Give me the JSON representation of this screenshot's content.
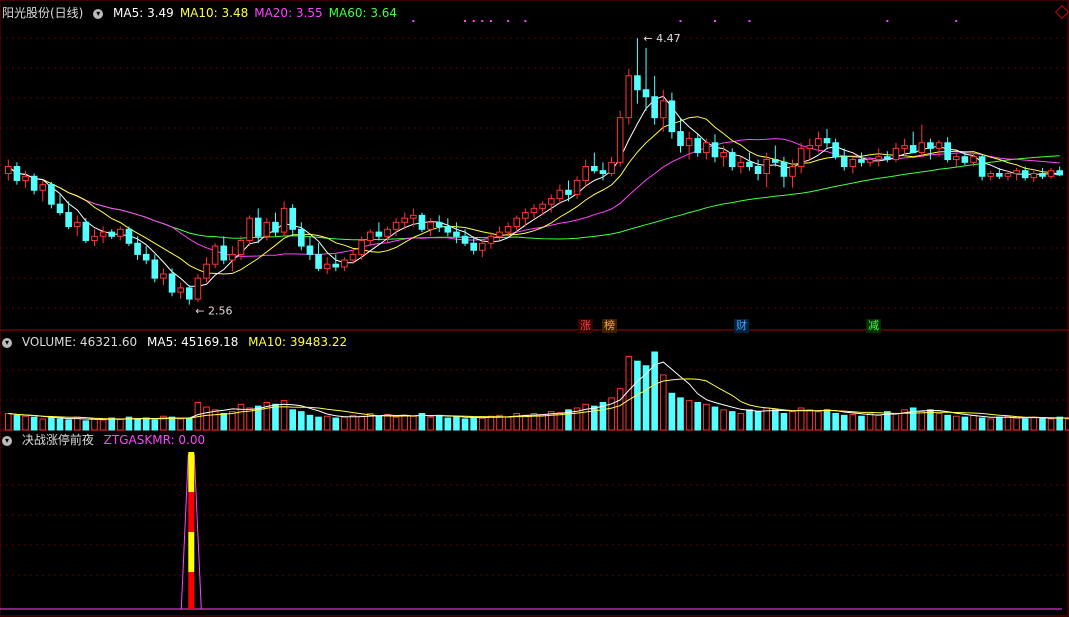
{
  "main_panel": {
    "title": "阳光股份(日线)",
    "ma_labels": [
      {
        "text": "MA5: 3.49",
        "color": "#ffffff"
      },
      {
        "text": "MA10: 3.48",
        "color": "#ffff44"
      },
      {
        "text": "MA20: 3.55",
        "color": "#ff44ff"
      },
      {
        "text": "MA60: 3.64",
        "color": "#44ff44"
      }
    ],
    "high_label": "4.47",
    "low_label": "2.56",
    "markers": [
      {
        "text": "涨",
        "color": "#ff4444",
        "bg": "#3a0000"
      },
      {
        "text": "榜",
        "color": "#ffaa44",
        "bg": "#3a2000"
      },
      {
        "text": "财",
        "color": "#44aaff",
        "bg": "#002040"
      },
      {
        "text": "减",
        "color": "#44ff44",
        "bg": "#003000"
      }
    ]
  },
  "volume_panel": {
    "title": "VOLUME: 46321.60",
    "ma5": "MA5: 45169.18",
    "ma10": "MA10: 39483.22"
  },
  "indicator_panel": {
    "title": "决战涨停前夜",
    "value": "ZTGASKMR: 0.00"
  },
  "chart_data": {
    "type": "candlestick",
    "ma_current": {
      "MA5": 3.49,
      "MA10": 3.48,
      "MA20": 3.55,
      "MA60": 3.64
    },
    "price_high": 4.47,
    "price_low": 2.56,
    "price_range": [
      2.45,
      4.6
    ],
    "candles": [
      [
        3.5,
        3.6,
        3.45,
        3.55
      ],
      [
        3.55,
        3.58,
        3.42,
        3.45
      ],
      [
        3.45,
        3.52,
        3.4,
        3.48
      ],
      [
        3.48,
        3.5,
        3.35,
        3.38
      ],
      [
        3.38,
        3.45,
        3.3,
        3.42
      ],
      [
        3.42,
        3.44,
        3.25,
        3.28
      ],
      [
        3.28,
        3.35,
        3.2,
        3.22
      ],
      [
        3.22,
        3.3,
        3.1,
        3.12
      ],
      [
        3.12,
        3.2,
        3.05,
        3.15
      ],
      [
        3.15,
        3.18,
        3.0,
        3.02
      ],
      [
        3.02,
        3.1,
        2.98,
        3.05
      ],
      [
        3.05,
        3.12,
        3.0,
        3.08
      ],
      [
        3.08,
        3.1,
        3.03,
        3.05
      ],
      [
        3.05,
        3.12,
        3.02,
        3.1
      ],
      [
        3.1,
        3.12,
        2.98,
        3.0
      ],
      [
        3.0,
        3.05,
        2.88,
        2.92
      ],
      [
        2.92,
        2.98,
        2.85,
        2.88
      ],
      [
        2.88,
        2.92,
        2.72,
        2.75
      ],
      [
        2.75,
        2.82,
        2.7,
        2.78
      ],
      [
        2.78,
        2.82,
        2.62,
        2.65
      ],
      [
        2.65,
        2.72,
        2.6,
        2.68
      ],
      [
        2.68,
        2.7,
        2.56,
        2.6
      ],
      [
        2.6,
        2.78,
        2.58,
        2.75
      ],
      [
        2.75,
        2.9,
        2.72,
        2.85
      ],
      [
        2.85,
        3.0,
        2.82,
        2.98
      ],
      [
        2.98,
        3.05,
        2.85,
        2.88
      ],
      [
        2.88,
        2.98,
        2.8,
        2.92
      ],
      [
        2.92,
        3.05,
        2.88,
        3.02
      ],
      [
        3.02,
        3.2,
        2.98,
        3.18
      ],
      [
        3.18,
        3.25,
        3.0,
        3.05
      ],
      [
        3.05,
        3.18,
        3.02,
        3.15
      ],
      [
        3.15,
        3.22,
        3.05,
        3.08
      ],
      [
        3.08,
        3.3,
        3.05,
        3.25
      ],
      [
        3.25,
        3.28,
        3.05,
        3.1
      ],
      [
        3.1,
        3.15,
        2.95,
        2.98
      ],
      [
        2.98,
        3.05,
        2.88,
        2.92
      ],
      [
        2.92,
        3.0,
        2.8,
        2.82
      ],
      [
        2.82,
        2.9,
        2.78,
        2.85
      ],
      [
        2.85,
        2.92,
        2.8,
        2.83
      ],
      [
        2.83,
        2.9,
        2.8,
        2.88
      ],
      [
        2.88,
        2.95,
        2.85,
        2.92
      ],
      [
        2.92,
        3.05,
        2.88,
        3.02
      ],
      [
        3.02,
        3.1,
        2.98,
        3.08
      ],
      [
        3.08,
        3.15,
        3.02,
        3.05
      ],
      [
        3.05,
        3.12,
        3.0,
        3.1
      ],
      [
        3.1,
        3.18,
        3.05,
        3.15
      ],
      [
        3.15,
        3.22,
        3.1,
        3.18
      ],
      [
        3.18,
        3.25,
        3.12,
        3.2
      ],
      [
        3.2,
        3.22,
        3.08,
        3.1
      ],
      [
        3.1,
        3.18,
        3.05,
        3.15
      ],
      [
        3.15,
        3.2,
        3.08,
        3.12
      ],
      [
        3.12,
        3.18,
        3.05,
        3.08
      ],
      [
        3.08,
        3.15,
        3.0,
        3.05
      ],
      [
        3.05,
        3.1,
        2.98,
        3.0
      ],
      [
        3.0,
        3.05,
        2.92,
        2.95
      ],
      [
        2.95,
        3.02,
        2.9,
        3.0
      ],
      [
        3.0,
        3.08,
        2.96,
        3.05
      ],
      [
        3.05,
        3.12,
        3.02,
        3.08
      ],
      [
        3.08,
        3.15,
        3.05,
        3.12
      ],
      [
        3.12,
        3.2,
        3.08,
        3.18
      ],
      [
        3.18,
        3.25,
        3.12,
        3.22
      ],
      [
        3.22,
        3.28,
        3.18,
        3.25
      ],
      [
        3.25,
        3.3,
        3.2,
        3.28
      ],
      [
        3.28,
        3.35,
        3.22,
        3.32
      ],
      [
        3.32,
        3.42,
        3.28,
        3.38
      ],
      [
        3.38,
        3.45,
        3.3,
        3.35
      ],
      [
        3.35,
        3.48,
        3.32,
        3.45
      ],
      [
        3.45,
        3.6,
        3.4,
        3.55
      ],
      [
        3.55,
        3.65,
        3.5,
        3.52
      ],
      [
        3.52,
        3.58,
        3.45,
        3.5
      ],
      [
        3.5,
        3.62,
        3.48,
        3.58
      ],
      [
        3.58,
        3.95,
        3.55,
        3.9
      ],
      [
        3.9,
        4.25,
        3.85,
        4.2
      ],
      [
        4.2,
        4.47,
        4.0,
        4.1
      ],
      [
        4.1,
        4.4,
        3.95,
        4.05
      ],
      [
        4.05,
        4.2,
        3.85,
        3.9
      ],
      [
        3.9,
        4.1,
        3.8,
        4.02
      ],
      [
        4.02,
        4.08,
        3.75,
        3.8
      ],
      [
        3.8,
        3.9,
        3.65,
        3.7
      ],
      [
        3.7,
        3.8,
        3.6,
        3.75
      ],
      [
        3.75,
        3.78,
        3.62,
        3.65
      ],
      [
        3.65,
        3.75,
        3.6,
        3.72
      ],
      [
        3.72,
        3.78,
        3.58,
        3.62
      ],
      [
        3.62,
        3.7,
        3.55,
        3.65
      ],
      [
        3.65,
        3.68,
        3.52,
        3.55
      ],
      [
        3.55,
        3.62,
        3.5,
        3.58
      ],
      [
        3.58,
        3.65,
        3.52,
        3.55
      ],
      [
        3.55,
        3.6,
        3.45,
        3.5
      ],
      [
        3.5,
        3.65,
        3.4,
        3.6
      ],
      [
        3.6,
        3.7,
        3.55,
        3.58
      ],
      [
        3.58,
        3.62,
        3.4,
        3.48
      ],
      [
        3.48,
        3.6,
        3.4,
        3.55
      ],
      [
        3.55,
        3.72,
        3.5,
        3.68
      ],
      [
        3.68,
        3.75,
        3.6,
        3.7
      ],
      [
        3.7,
        3.8,
        3.65,
        3.75
      ],
      [
        3.75,
        3.82,
        3.68,
        3.72
      ],
      [
        3.72,
        3.75,
        3.6,
        3.62
      ],
      [
        3.62,
        3.68,
        3.52,
        3.55
      ],
      [
        3.55,
        3.62,
        3.5,
        3.6
      ],
      [
        3.6,
        3.65,
        3.55,
        3.58
      ],
      [
        3.58,
        3.62,
        3.55,
        3.6
      ],
      [
        3.6,
        3.68,
        3.55,
        3.62
      ],
      [
        3.62,
        3.66,
        3.58,
        3.6
      ],
      [
        3.6,
        3.72,
        3.58,
        3.68
      ],
      [
        3.68,
        3.75,
        3.62,
        3.7
      ],
      [
        3.7,
        3.8,
        3.65,
        3.65
      ],
      [
        3.65,
        3.85,
        3.62,
        3.72
      ],
      [
        3.72,
        3.75,
        3.6,
        3.68
      ],
      [
        3.68,
        3.74,
        3.62,
        3.72
      ],
      [
        3.72,
        3.76,
        3.58,
        3.6
      ],
      [
        3.6,
        3.65,
        3.55,
        3.62
      ],
      [
        3.62,
        3.66,
        3.56,
        3.58
      ],
      [
        3.58,
        3.64,
        3.55,
        3.62
      ],
      [
        3.62,
        3.64,
        3.45,
        3.48
      ],
      [
        3.48,
        3.52,
        3.45,
        3.5
      ],
      [
        3.5,
        3.54,
        3.46,
        3.48
      ],
      [
        3.48,
        3.52,
        3.45,
        3.5
      ],
      [
        3.5,
        3.54,
        3.45,
        3.52
      ],
      [
        3.52,
        3.55,
        3.45,
        3.47
      ],
      [
        3.47,
        3.52,
        3.44,
        3.5
      ],
      [
        3.5,
        3.54,
        3.46,
        3.48
      ],
      [
        3.48,
        3.54,
        3.46,
        3.52
      ],
      [
        3.52,
        3.55,
        3.48,
        3.49
      ]
    ],
    "volume": [
      18,
      16,
      15,
      14,
      12,
      13,
      12,
      11,
      14,
      10,
      12,
      11,
      13,
      12,
      14,
      12,
      13,
      11,
      15,
      14,
      12,
      13,
      30,
      25,
      22,
      18,
      20,
      28,
      24,
      26,
      30,
      28,
      32,
      22,
      20,
      16,
      14,
      15,
      13,
      14,
      16,
      15,
      18,
      15,
      17,
      14,
      16,
      15,
      18,
      14,
      16,
      13,
      15,
      12,
      14,
      13,
      15,
      16,
      14,
      18,
      16,
      18,
      17,
      20,
      19,
      22,
      24,
      28,
      26,
      30,
      35,
      45,
      80,
      75,
      70,
      85,
      60,
      40,
      35,
      32,
      30,
      28,
      25,
      22,
      20,
      18,
      22,
      20,
      24,
      22,
      18,
      20,
      24,
      22,
      20,
      22,
      18,
      16,
      17,
      15,
      18,
      16,
      20,
      18,
      22,
      24,
      20,
      22,
      18,
      16,
      15,
      14,
      16,
      13,
      12,
      14,
      15,
      13,
      12,
      14,
      13,
      12,
      14,
      12,
      15
    ]
  }
}
